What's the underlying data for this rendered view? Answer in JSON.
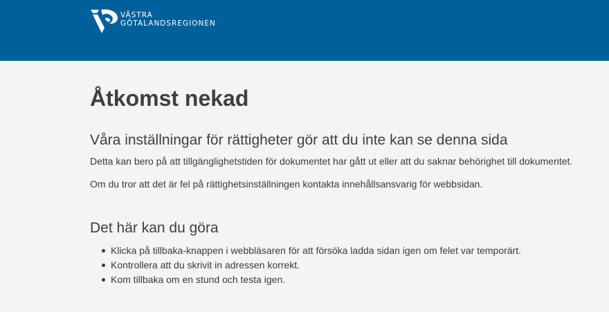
{
  "header": {
    "logo_line1": "VÄSTRA",
    "logo_line2": "GÖTALANDSREGIONEN",
    "background_color": "#00609c"
  },
  "main": {
    "title": "Åtkomst nekad",
    "subtitle": "Våra inställningar för rättigheter gör att du inte kan se denna sida",
    "paragraphs": [
      "Detta kan bero på att tillgänglighetstiden för dokumentet har gått ut eller att du saknar behörighet till dokumentet.",
      "Om du tror att det är fel på rättighetsinställningen kontakta innehållsansvarig för webbsidan."
    ],
    "actions_heading": "Det här kan du göra",
    "actions": [
      "Klicka på tillbaka-knappen i webbläsaren för att försöka ladda sidan igen om felet var temporärt.",
      "Kontrollera att du skrivit in adressen korrekt.",
      "Kom tillbaka om en stund och testa igen."
    ]
  }
}
